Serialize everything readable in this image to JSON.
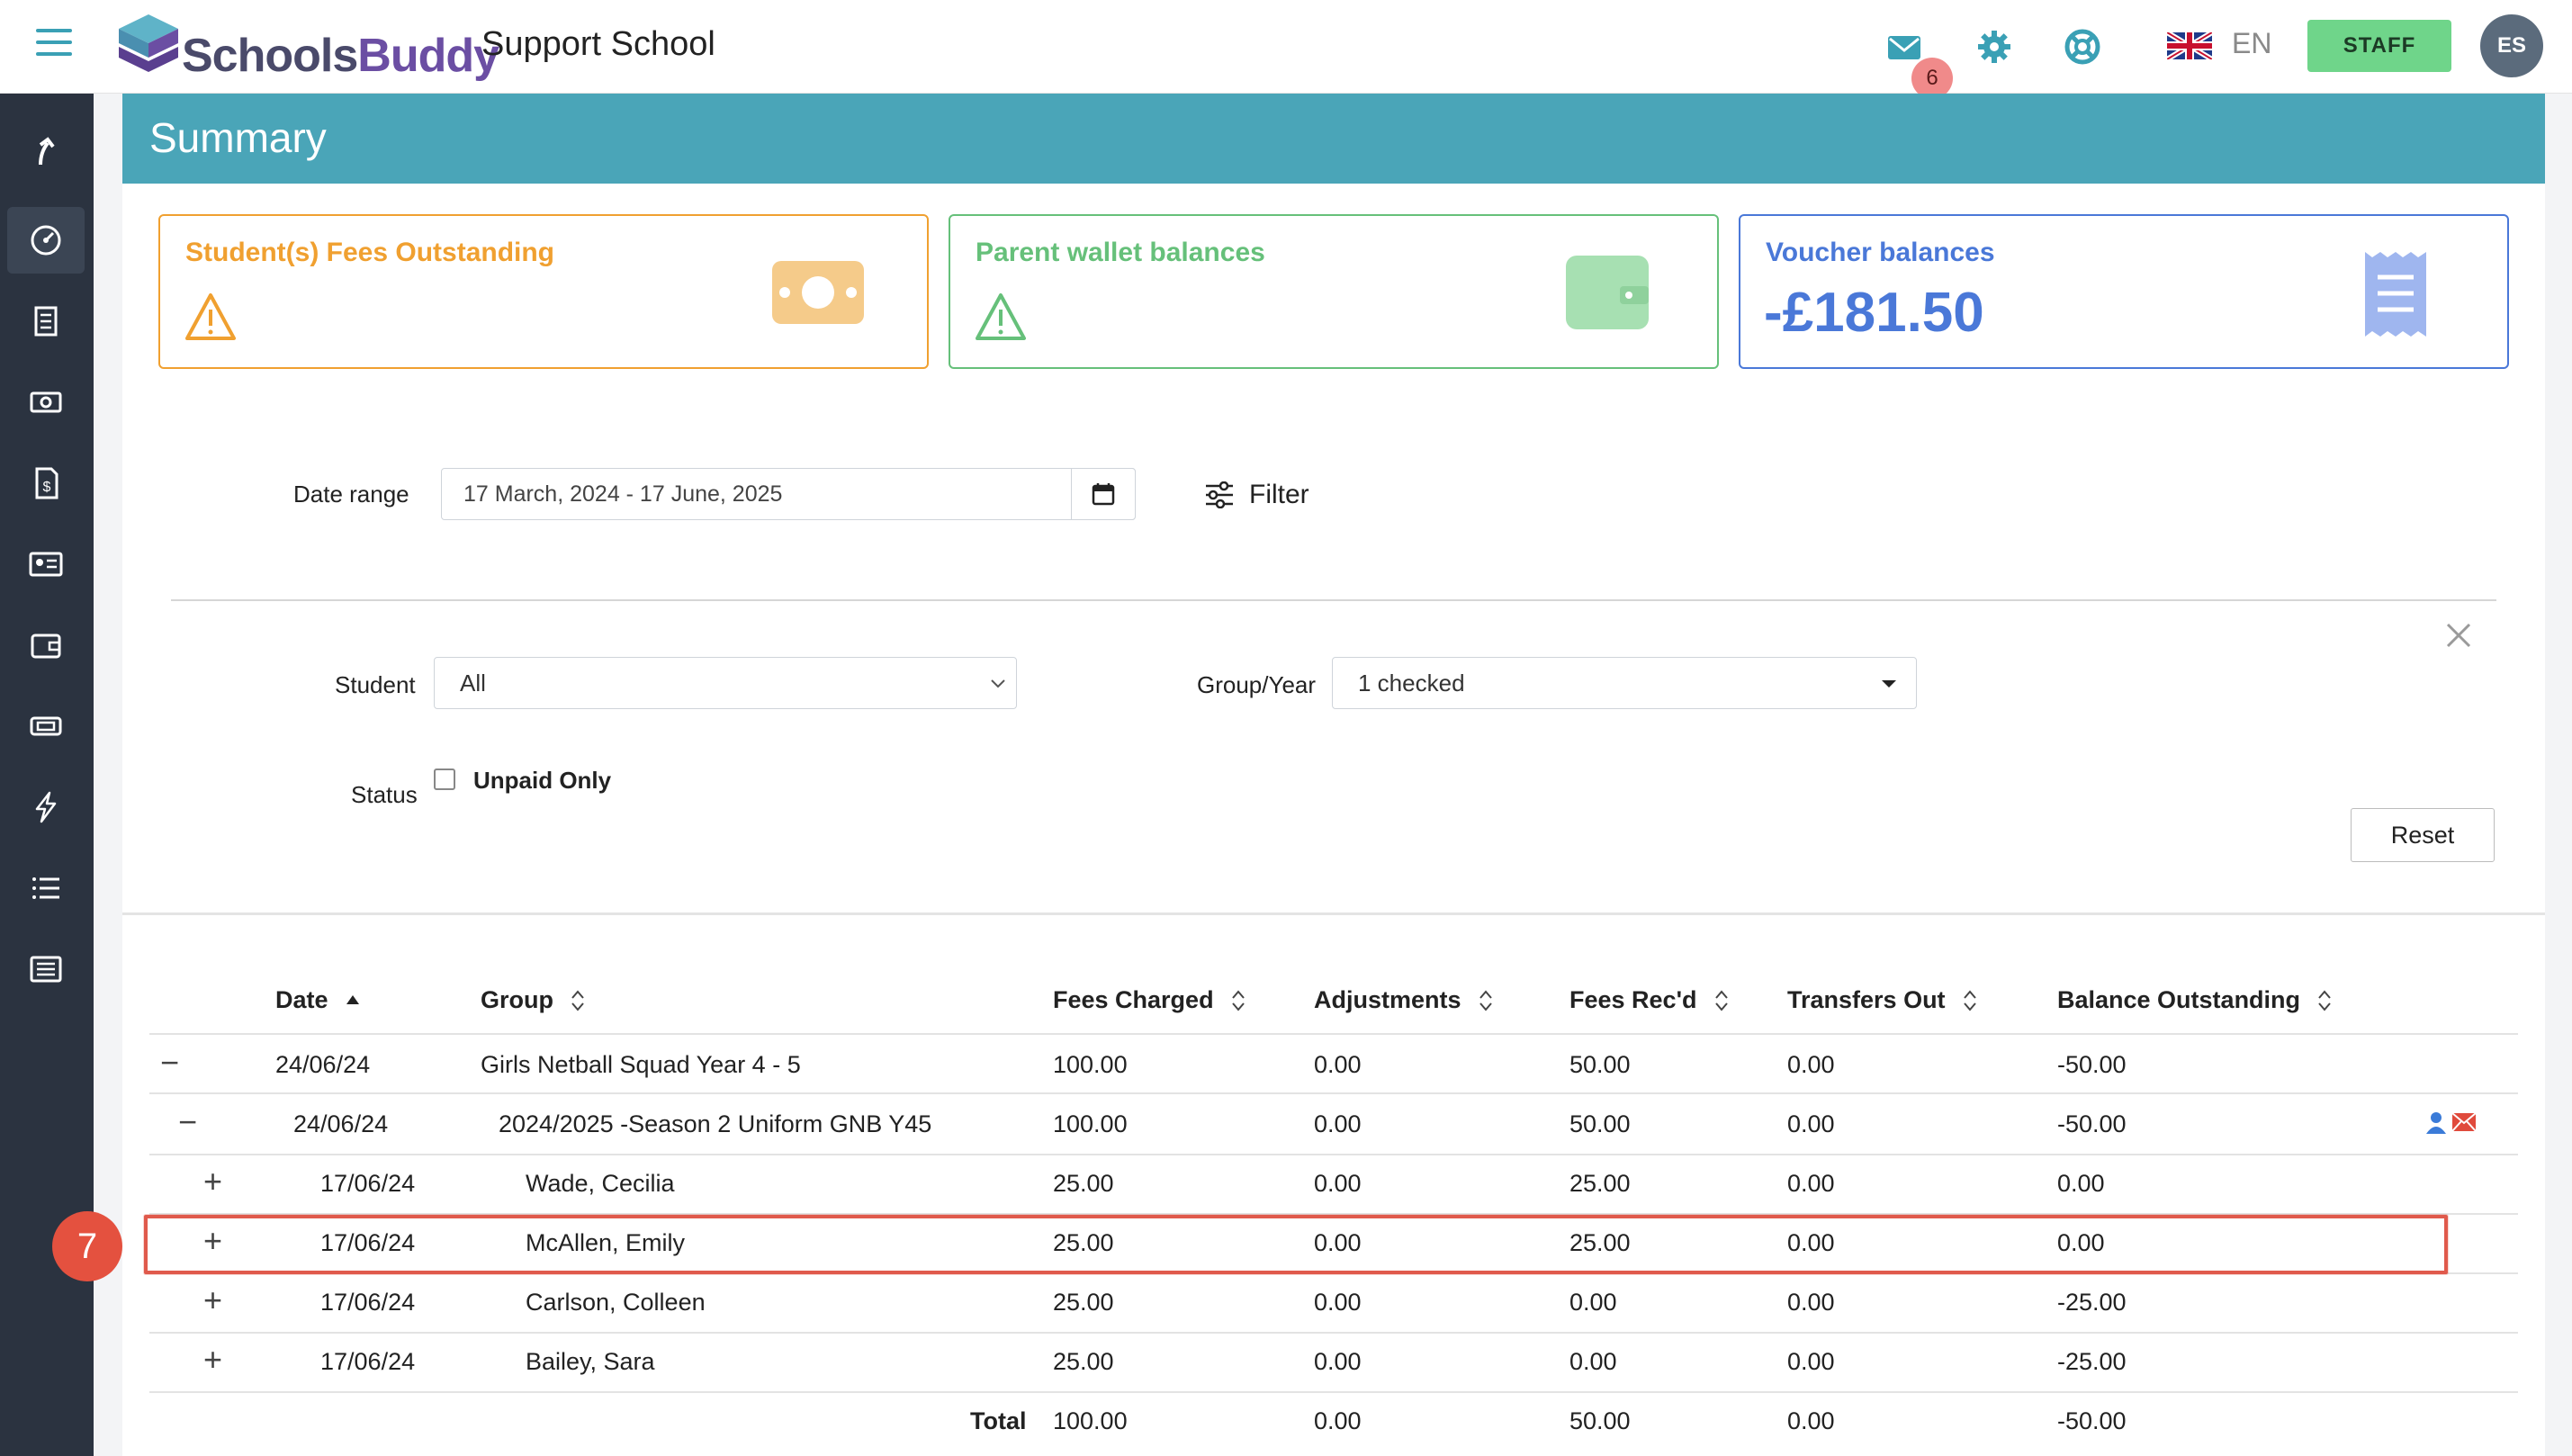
{
  "app": {
    "logo_part1": "Schools",
    "logo_part2": "Buddy",
    "school_name": "Support School",
    "unread_count": "6",
    "language": "EN",
    "staff_label": "STAFF",
    "avatar_initials": "ES"
  },
  "page": {
    "title": "Summary"
  },
  "cards": [
    {
      "title": "Student(s) Fees Outstanding",
      "value": "",
      "status": "warning",
      "color": "#f0a030"
    },
    {
      "title": "Parent wallet balances",
      "value": "",
      "status": "warning",
      "color": "#66c07a"
    },
    {
      "title": "Voucher balances",
      "value": "-£181.50",
      "status": "value",
      "color": "#4a78d8"
    }
  ],
  "filters": {
    "date_range_label": "Date range",
    "date_range_value": "17 March, 2024 - 17 June, 2025",
    "filter_label": "Filter",
    "student_label": "Student",
    "student_value": "All",
    "group_year_label": "Group/Year",
    "group_year_value": "1 checked",
    "status_label": "Status",
    "unpaid_only_label": "Unpaid Only",
    "reset_label": "Reset"
  },
  "table": {
    "headers": {
      "date": "Date",
      "group": "Group",
      "fees_charged": "Fees Charged",
      "adjustments": "Adjustments",
      "fees_recd": "Fees Rec'd",
      "transfers_out": "Transfers Out",
      "balance_outstanding": "Balance Outstanding"
    },
    "rows": [
      {
        "toggle": "−",
        "date": "24/06/24",
        "group": "Girls Netball Squad Year 4 - 5",
        "fees_charged": "100.00",
        "adjustments": "0.00",
        "fees_recd": "50.00",
        "transfers_out": "0.00",
        "balance": "-50.00"
      },
      {
        "toggle": "−",
        "date": "24/06/24",
        "group": "2024/2025 -Season 2 Uniform GNB Y45",
        "fees_charged": "100.00",
        "adjustments": "0.00",
        "fees_recd": "50.00",
        "transfers_out": "0.00",
        "balance": "-50.00"
      },
      {
        "toggle": "+",
        "date": "17/06/24",
        "group": "Wade, Cecilia",
        "fees_charged": "25.00",
        "adjustments": "0.00",
        "fees_recd": "25.00",
        "transfers_out": "0.00",
        "balance": "0.00"
      },
      {
        "toggle": "+",
        "date": "17/06/24",
        "group": "McAllen, Emily",
        "fees_charged": "25.00",
        "adjustments": "0.00",
        "fees_recd": "25.00",
        "transfers_out": "0.00",
        "balance": "0.00"
      },
      {
        "toggle": "+",
        "date": "17/06/24",
        "group": "Carlson, Colleen",
        "fees_charged": "25.00",
        "adjustments": "0.00",
        "fees_recd": "0.00",
        "transfers_out": "0.00",
        "balance": "-25.00"
      },
      {
        "toggle": "+",
        "date": "17/06/24",
        "group": "Bailey, Sara",
        "fees_charged": "25.00",
        "adjustments": "0.00",
        "fees_recd": "0.00",
        "transfers_out": "0.00",
        "balance": "-25.00"
      }
    ],
    "total": {
      "label": "Total",
      "fees_charged": "100.00",
      "adjustments": "0.00",
      "fees_recd": "50.00",
      "transfers_out": "0.00",
      "balance": "-50.00"
    }
  },
  "annotation": {
    "step_number": "7"
  },
  "icons": {
    "topbar": [
      "hamburger-icon",
      "mail-icon",
      "gear-icon",
      "support-icon",
      "uk-flag-icon"
    ],
    "sidebar": [
      "back-arrow-icon",
      "dashboard-icon",
      "receipt-icon",
      "money-icon",
      "invoice-icon",
      "id-card-icon",
      "wallet-icon",
      "ticket-icon",
      "lightning-icon",
      "list-icon",
      "report-icon"
    ],
    "row_actions": [
      "user-icon",
      "email-icon"
    ]
  },
  "colors": {
    "header_teal": "#4aa5b8",
    "sidebar_dark": "#2b3340",
    "staff_green": "#6fd58a",
    "highlight_red": "#e05a4c"
  }
}
